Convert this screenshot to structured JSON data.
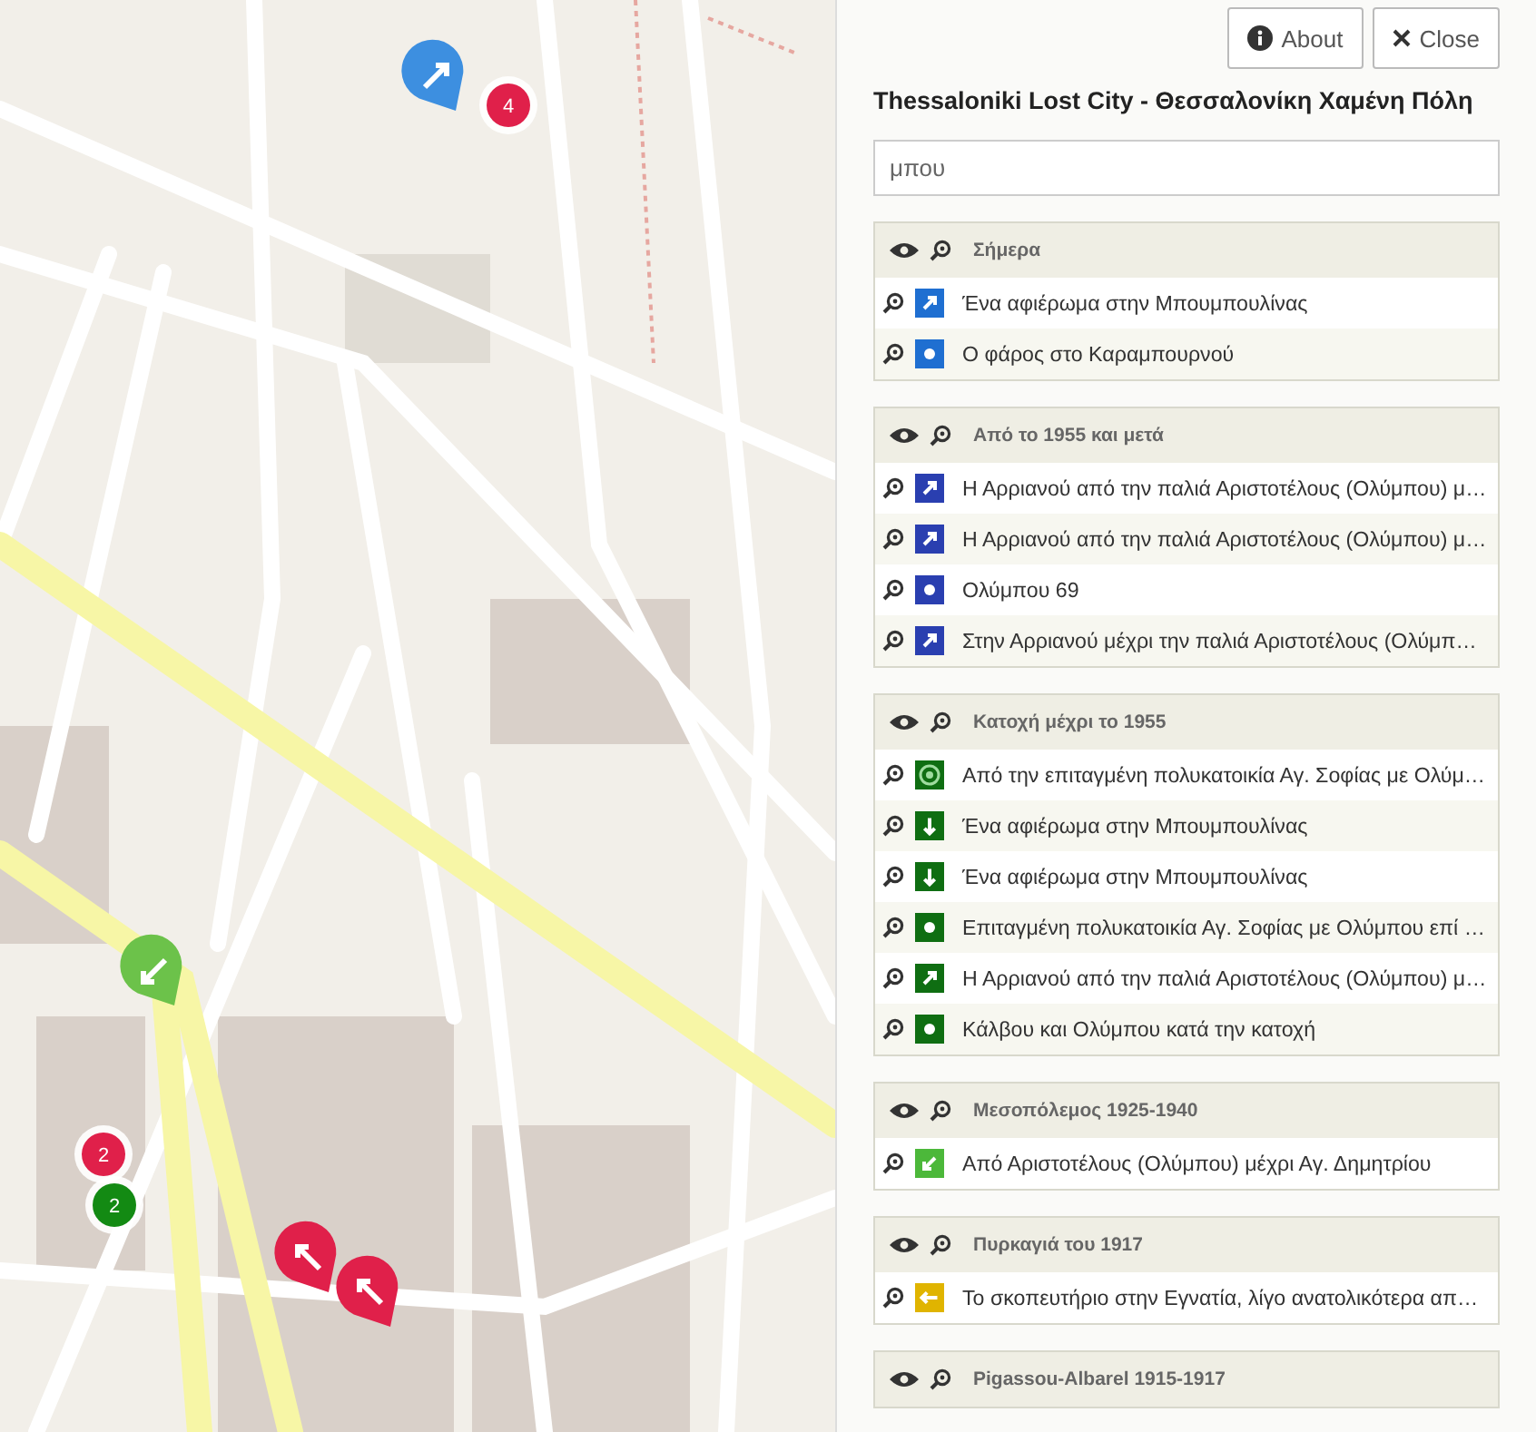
{
  "map": {
    "markers": [
      {
        "kind": "pin",
        "color": "#3d8fe0"
      },
      {
        "kind": "cluster",
        "color": "#e0204a",
        "label": "4"
      },
      {
        "kind": "pin",
        "color": "#6cc24a"
      },
      {
        "kind": "cluster",
        "color": "#e0204a",
        "label": "2"
      },
      {
        "kind": "cluster",
        "color": "#138a13",
        "label": "2"
      },
      {
        "kind": "pin",
        "color": "#e0204a"
      },
      {
        "kind": "pin",
        "color": "#e0204a"
      }
    ]
  },
  "panel": {
    "buttons": [
      {
        "kind": "about",
        "label": "About"
      },
      {
        "kind": "close",
        "label": "Close"
      }
    ],
    "title": "Thessaloniki Lost City - Θεσσαλονίκη Χαμένη Πόλη",
    "search": {
      "value": "μπου"
    },
    "groups": [
      {
        "title": "Σήμερα",
        "items": [
          {
            "label": "Ένα αφιέρωμα στην Μπουμπουλίνας",
            "kind": "arrow-ne",
            "color": "#1f6fd1"
          },
          {
            "label": "Ο φάρος στο Καραμπουρνού",
            "kind": "dot",
            "color": "#1f6fd1"
          }
        ]
      },
      {
        "title": "Από το 1955 και μετά",
        "items": [
          {
            "label": "Η Αρριανού από την παλιά Αριστοτέλους (Ολύμπου) μ…",
            "kind": "arrow-ne",
            "color": "#2a3fb0"
          },
          {
            "label": "Η Αρριανού από την παλιά Αριστοτέλους (Ολύμπου) μ…",
            "kind": "arrow-ne",
            "color": "#2a3fb0"
          },
          {
            "label": "Ολύμπου 69",
            "kind": "dot",
            "color": "#2a3fb0"
          },
          {
            "label": "Στην Αρριανού μέχρι την παλιά Αριστοτέλους (Ολύμπ…",
            "kind": "arrow-ne",
            "color": "#2a3fb0"
          }
        ]
      },
      {
        "title": "Κατοχή μέχρι το 1955",
        "items": [
          {
            "label": "Από την επιταγμένη πολυκατοικία Αγ. Σοφίας με Ολύμ…",
            "kind": "target",
            "color": "#0f6e12"
          },
          {
            "label": "Ένα αφιέρωμα στην Μπουμπουλίνας",
            "kind": "arrow-down",
            "color": "#0f6e12"
          },
          {
            "label": "Ένα αφιέρωμα στην Μπουμπουλίνας",
            "kind": "arrow-down",
            "color": "#0f6e12"
          },
          {
            "label": "Επιταγμένη πολυκατοικία Αγ. Σοφίας με Ολύμπου επί …",
            "kind": "dot",
            "color": "#0f6e12"
          },
          {
            "label": "Η Αρριανού από την παλιά Αριστοτέλους (Ολύμπου) μ…",
            "kind": "arrow-ne",
            "color": "#0f6e12"
          },
          {
            "label": "Κάλβου και Ολύμπου κατά την κατοχή",
            "kind": "dot",
            "color": "#0f6e12"
          }
        ]
      },
      {
        "title": "Μεσοπόλεμος 1925-1940",
        "items": [
          {
            "label": "Από Αριστοτέλους (Ολύμπου) μέχρι Αγ. Δημητρίου",
            "kind": "arrow-sw",
            "color": "#4cb83a"
          }
        ]
      },
      {
        "title": "Πυρκαγιά του 1917",
        "items": [
          {
            "label": "Το σκοπευτήριο στην Εγνατία, λίγο ανατολικότερα απ…",
            "kind": "arrow-w",
            "color": "#e0b400"
          }
        ]
      },
      {
        "title": "Pigassou-Albarel 1915-1917"
      }
    ]
  }
}
